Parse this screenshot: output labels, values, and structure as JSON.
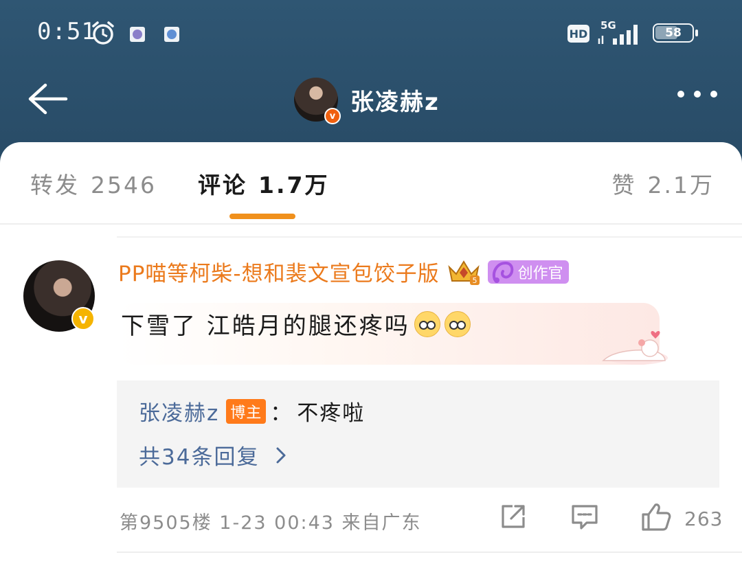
{
  "status_bar": {
    "time": "0:51",
    "hd": "HD",
    "network": "5G",
    "battery": "58",
    "icons": [
      "alarm-icon",
      "app-notification-icon",
      "app-notification-icon-2",
      "hd-icon",
      "signal-icon",
      "battery-icon"
    ]
  },
  "topbar": {
    "author_name": "张凌赫z",
    "verified_mark": "v",
    "icons": [
      "back-arrow-icon",
      "more-icon"
    ]
  },
  "tabs": {
    "repost": {
      "label": "转发",
      "count": "2546"
    },
    "comment": {
      "label": "评论",
      "count": "1.7万"
    },
    "like": {
      "label": "赞",
      "count": "2.1万"
    },
    "active": "comment",
    "accent_color": "#f0901c"
  },
  "comment": {
    "user_name": "PP喵等柯柴-想和裴文宣包饺子版",
    "level_badge": "5",
    "creator_badge": "创作官",
    "verified_mark": "v",
    "text": "下雪了 江皓月的腿还疼吗",
    "emojis": [
      "pleading-face-emoji",
      "pleading-face-emoji"
    ],
    "reply": {
      "author": "张凌赫z",
      "author_badge": "博主",
      "separator": "：",
      "text": "不疼啦",
      "more_label": "共34条回复"
    },
    "meta": "第9505楼 1-23 00:43 来自广东",
    "like_count": "263",
    "icons": [
      "share-icon",
      "comment-icon",
      "like-icon"
    ]
  },
  "colors": {
    "header_bg": "#2c5270",
    "username_orange": "#eb7a1c",
    "reply_blue": "#4b6a99",
    "bozhu_badge": "#ff7a1a",
    "creator_badge": "#cf8ff0"
  }
}
